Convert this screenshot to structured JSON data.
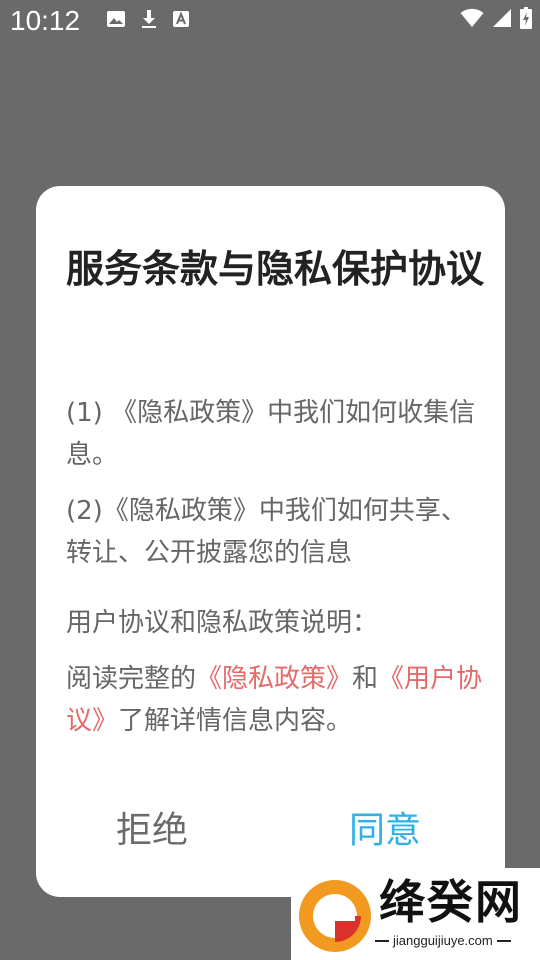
{
  "status_bar": {
    "time": "10:12",
    "left_icons": [
      "image-icon",
      "download-icon",
      "font-icon"
    ],
    "right_icons": [
      "wifi-icon",
      "signal-icon",
      "battery-charging-icon"
    ]
  },
  "dialog": {
    "title": "服务条款与隐私保护协议",
    "paragraph_1": "(1) 《隐私政策》中我们如何收集信息。",
    "paragraph_2": "(2)《隐私政策》中我们如何共享、转让、公开披露您的信息",
    "paragraph_3": "用户协议和隐私政策说明：",
    "paragraph_4": {
      "prefix": "阅读完整的",
      "link_privacy": "《隐私政策》",
      "middle": "和",
      "link_terms": "《用户协议》",
      "suffix": "了解详情信息内容。"
    },
    "reject_label": "拒绝",
    "agree_label": "同意"
  },
  "watermark": {
    "brand": "绛癸网",
    "url": "jiangguijiuye.com"
  },
  "colors": {
    "overlay": "#6a6a6a",
    "link": "#e56a6a",
    "agree": "#2fb0e6",
    "reject": "#6b6b6b"
  }
}
